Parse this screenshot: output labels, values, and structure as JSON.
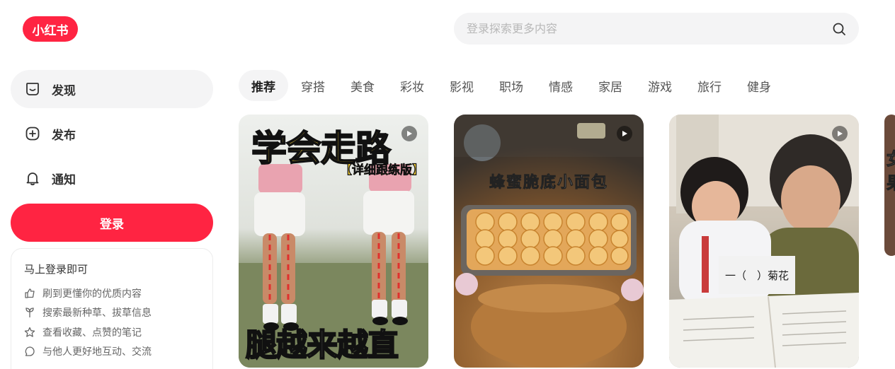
{
  "logo": {
    "text": "小红书"
  },
  "search": {
    "placeholder": "登录探索更多内容"
  },
  "sidebar": {
    "items": [
      {
        "label": "发现",
        "icon": "discover-icon",
        "active": true
      },
      {
        "label": "发布",
        "icon": "plus-square-icon",
        "active": false
      },
      {
        "label": "通知",
        "icon": "bell-icon",
        "active": false
      }
    ],
    "login_label": "登录",
    "promo": {
      "title": "马上登录即可",
      "items": [
        {
          "icon": "thumbs-up-icon",
          "label": "刷到更懂你的优质内容"
        },
        {
          "icon": "sprout-icon",
          "label": "搜索最新种草、拔草信息"
        },
        {
          "icon": "star-icon",
          "label": "查看收藏、点赞的笔记"
        },
        {
          "icon": "chat-bubble-icon",
          "label": "与他人更好地互动、交流"
        }
      ]
    }
  },
  "tabs": [
    "推荐",
    "穿搭",
    "美食",
    "彩妆",
    "影视",
    "职场",
    "情感",
    "家居",
    "游戏",
    "旅行",
    "健身"
  ],
  "feed": {
    "cards": [
      {
        "title_top": "学会走路",
        "subtitle": "【详细跟练版】",
        "title_bottom": "腿越来越直",
        "has_video": true
      },
      {
        "title_top": "蜂蜜脆底小面包",
        "has_video": true
      },
      {
        "overlay_text": "一（　）菊花",
        "has_video": true
      }
    ],
    "partial_card_text": "女\n果"
  },
  "colors": {
    "brand": "#ff2442",
    "nav_active_bg": "#f4f4f5"
  }
}
